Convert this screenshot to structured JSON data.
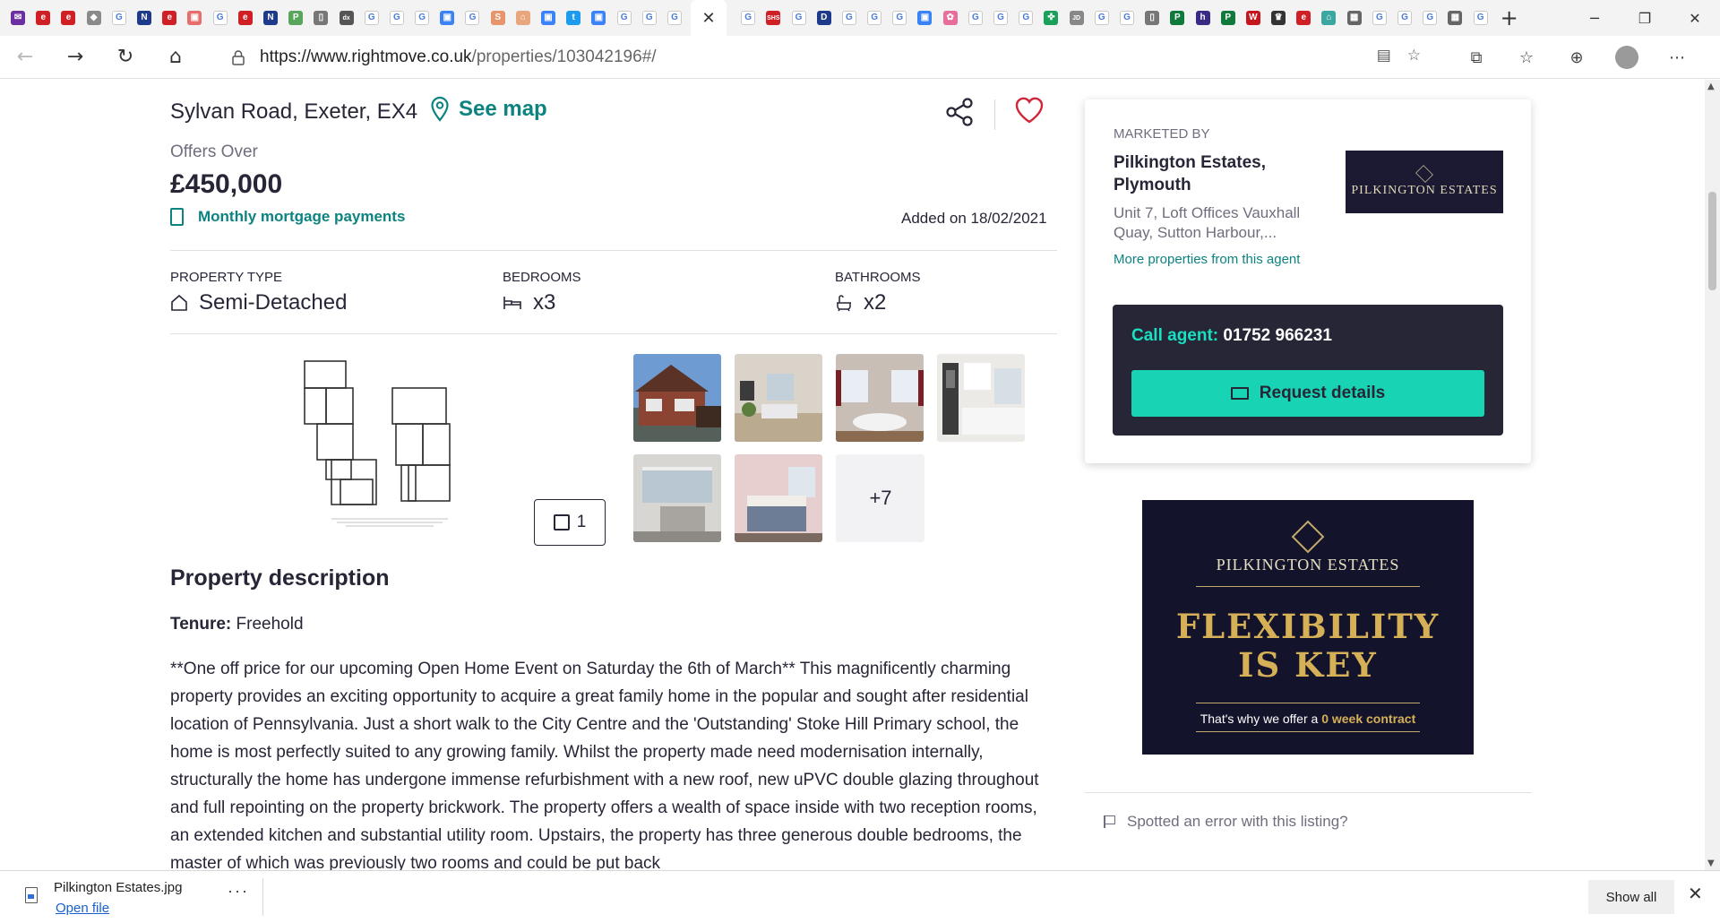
{
  "browser": {
    "favicon_tabs": [
      {
        "icon": "mail-icon",
        "glyph": "✉",
        "color": "#6b2fa0"
      },
      {
        "icon": "e-red-icon",
        "glyph": "e",
        "color": "#d11f26"
      },
      {
        "icon": "e-red-icon",
        "glyph": "e",
        "color": "#d11f26"
      },
      {
        "icon": "club-crest-icon",
        "glyph": "◆",
        "color": "#8a8a8a"
      },
      {
        "icon": "google-icon",
        "glyph": "G",
        "color": "#ffffff"
      },
      {
        "icon": "n-icon",
        "glyph": "N",
        "color": "#1e3a8a"
      },
      {
        "icon": "e-red-icon",
        "glyph": "e",
        "color": "#d11f26"
      },
      {
        "icon": "image-icon",
        "glyph": "▣",
        "color": "#e86d6d"
      },
      {
        "icon": "google-icon",
        "glyph": "G",
        "color": "#ffffff"
      },
      {
        "icon": "e-red-icon",
        "glyph": "e",
        "color": "#d11f26"
      },
      {
        "icon": "n-icon",
        "glyph": "N",
        "color": "#1e3a8a"
      },
      {
        "icon": "p-green-icon",
        "glyph": "P",
        "color": "#58a55c"
      },
      {
        "icon": "doc-icon",
        "glyph": "▯",
        "color": "#777777"
      },
      {
        "icon": "dx-icon",
        "glyph": "dx",
        "color": "#555555"
      },
      {
        "icon": "google-icon",
        "glyph": "G",
        "color": "#ffffff"
      },
      {
        "icon": "google-icon",
        "glyph": "G",
        "color": "#ffffff"
      },
      {
        "icon": "google-icon",
        "glyph": "G",
        "color": "#ffffff"
      },
      {
        "icon": "image-icon",
        "glyph": "▣",
        "color": "#3b82f6"
      },
      {
        "icon": "google-icon",
        "glyph": "G",
        "color": "#ffffff"
      },
      {
        "icon": "s-icon",
        "glyph": "S",
        "color": "#e9956b"
      },
      {
        "icon": "home-icon",
        "glyph": "⌂",
        "color": "#e9a57b"
      },
      {
        "icon": "image-icon",
        "glyph": "▣",
        "color": "#3b82f6"
      },
      {
        "icon": "twitter-icon",
        "glyph": "t",
        "color": "#1d9bf0"
      },
      {
        "icon": "image-icon",
        "glyph": "▣",
        "color": "#3b82f6"
      },
      {
        "icon": "google-icon",
        "glyph": "G",
        "color": "#ffffff"
      },
      {
        "icon": "google-icon",
        "glyph": "G",
        "color": "#ffffff"
      },
      {
        "icon": "google-icon",
        "glyph": "G",
        "color": "#ffffff"
      }
    ],
    "active_tab_close": "✕",
    "favicon_tabs_right": [
      {
        "icon": "google-icon",
        "glyph": "G",
        "color": "#ffffff"
      },
      {
        "icon": "shs-icon",
        "glyph": "SHS",
        "color": "#d11f26"
      },
      {
        "icon": "google-icon",
        "glyph": "G",
        "color": "#ffffff"
      },
      {
        "icon": "d-icon",
        "glyph": "D",
        "color": "#1e3a8a"
      },
      {
        "icon": "google-icon",
        "glyph": "G",
        "color": "#ffffff"
      },
      {
        "icon": "google-icon",
        "glyph": "G",
        "color": "#ffffff"
      },
      {
        "icon": "google-icon",
        "glyph": "G",
        "color": "#ffffff"
      },
      {
        "icon": "image-icon",
        "glyph": "▣",
        "color": "#3b82f6"
      },
      {
        "icon": "flower-icon",
        "glyph": "✿",
        "color": "#e86d9d"
      },
      {
        "icon": "google-icon",
        "glyph": "G",
        "color": "#ffffff"
      },
      {
        "icon": "google-icon",
        "glyph": "G",
        "color": "#ffffff"
      },
      {
        "icon": "google-icon",
        "glyph": "G",
        "color": "#ffffff"
      },
      {
        "icon": "runner-icon",
        "glyph": "✜",
        "color": "#19a05a"
      },
      {
        "icon": "jd-icon",
        "glyph": "JD",
        "color": "#888888"
      },
      {
        "icon": "google-icon",
        "glyph": "G",
        "color": "#ffffff"
      },
      {
        "icon": "google-icon",
        "glyph": "G",
        "color": "#ffffff"
      },
      {
        "icon": "doc-icon",
        "glyph": "▯",
        "color": "#777777"
      },
      {
        "icon": "p-green-icon",
        "glyph": "P",
        "color": "#0f7a3a"
      },
      {
        "icon": "h-icon",
        "glyph": "h",
        "color": "#3b2a85"
      },
      {
        "icon": "p-green-icon",
        "glyph": "P",
        "color": "#0f7a3a"
      },
      {
        "icon": "w-icon",
        "glyph": "W",
        "color": "#c4161c"
      },
      {
        "icon": "crown-icon",
        "glyph": "♛",
        "color": "#333333"
      },
      {
        "icon": "e-red-icon",
        "glyph": "e",
        "color": "#d11f26"
      },
      {
        "icon": "home-icon",
        "glyph": "⌂",
        "color": "#3aa7a0"
      },
      {
        "icon": "grid-icon",
        "glyph": "▦",
        "color": "#666666"
      },
      {
        "icon": "google-icon",
        "glyph": "G",
        "color": "#ffffff"
      },
      {
        "icon": "google-icon",
        "glyph": "G",
        "color": "#ffffff"
      },
      {
        "icon": "google-icon",
        "glyph": "G",
        "color": "#ffffff"
      },
      {
        "icon": "grid-icon",
        "glyph": "▦",
        "color": "#666666"
      },
      {
        "icon": "google-icon",
        "glyph": "G",
        "color": "#ffffff"
      }
    ],
    "new_tab": "+",
    "window_controls": [
      "─",
      "❐",
      "✕"
    ],
    "nav": {
      "back": "←",
      "forward": "→",
      "reload": "↻",
      "home": "⌂"
    },
    "url": {
      "host": "https://www.rightmove.co.uk",
      "path": "/properties/103042196#/"
    },
    "url_icons": [
      "▤",
      "☆"
    ],
    "toolbar_icons": [
      "⧉",
      "☆",
      "⊕",
      "⋯"
    ]
  },
  "listing": {
    "address": "Sylvan Road, Exeter, EX4",
    "see_map": "See map",
    "price_qualifier": "Offers Over",
    "price": "£450,000",
    "mortgage_link": "Monthly mortgage payments",
    "added_on": "Added on 18/02/2021",
    "key_details": [
      {
        "label": "PROPERTY TYPE",
        "value": "Semi-Detached",
        "icon": "house-icon"
      },
      {
        "label": "BEDROOMS",
        "value": "x3",
        "icon": "bed-icon"
      },
      {
        "label": "BATHROOMS",
        "value": "x2",
        "icon": "bath-icon"
      }
    ],
    "floorplan_count": "1",
    "more_photos": "+7",
    "description_heading": "Property description",
    "tenure_label": "Tenure:",
    "tenure_value": "Freehold",
    "description": "**One off price for our upcoming Open Home Event on Saturday the 6th of March** This magnificently charming property provides an exciting opportunity to acquire a great family home in the popular and sought after residential location of Pennsylvania. Just a short walk to the City Centre and the 'Outstanding' Stoke Hill Primary school, the home is most perfectly suited to any growing family. Whilst the property made need modernisation internally, structurally the home has undergone immense refurbishment with a new roof, new uPVC double glazing throughout and full repointing on the property brickwork. The property offers a wealth of space inside with two reception rooms, an extended kitchen and substantial utility room. Upstairs, the property has three generous double bedrooms, the master of which was previously two rooms and could be put back"
  },
  "agent": {
    "marketed_by": "MARKETED BY",
    "name": "Pilkington Estates, Plymouth",
    "address": "Unit 7, Loft Offices Vauxhall Quay, Sutton Harbour,...",
    "more_link": "More properties from this agent",
    "logo_text": "PILKINGTON ESTATES",
    "call_label": "Call agent:",
    "phone": "01752 966231",
    "request_button": "Request details"
  },
  "ad": {
    "brand": "PILKINGTON ESTATES",
    "headline_1": "FLEXIBILITY",
    "headline_2": "IS KEY",
    "tagline_pre": "That's why we offer a",
    "tagline_bold": "0 week contract"
  },
  "spotted_error": "Spotted an error with this listing?",
  "downloads": {
    "filename": "Pilkington Estates.jpg",
    "open_file": "Open file",
    "more": "···",
    "show_all": "Show all",
    "close": "✕"
  },
  "colors": {
    "accent_teal": "#0d8380",
    "cta_green": "#18d3b4",
    "dark_navy": "#262637",
    "heart_red": "#d1263a"
  }
}
